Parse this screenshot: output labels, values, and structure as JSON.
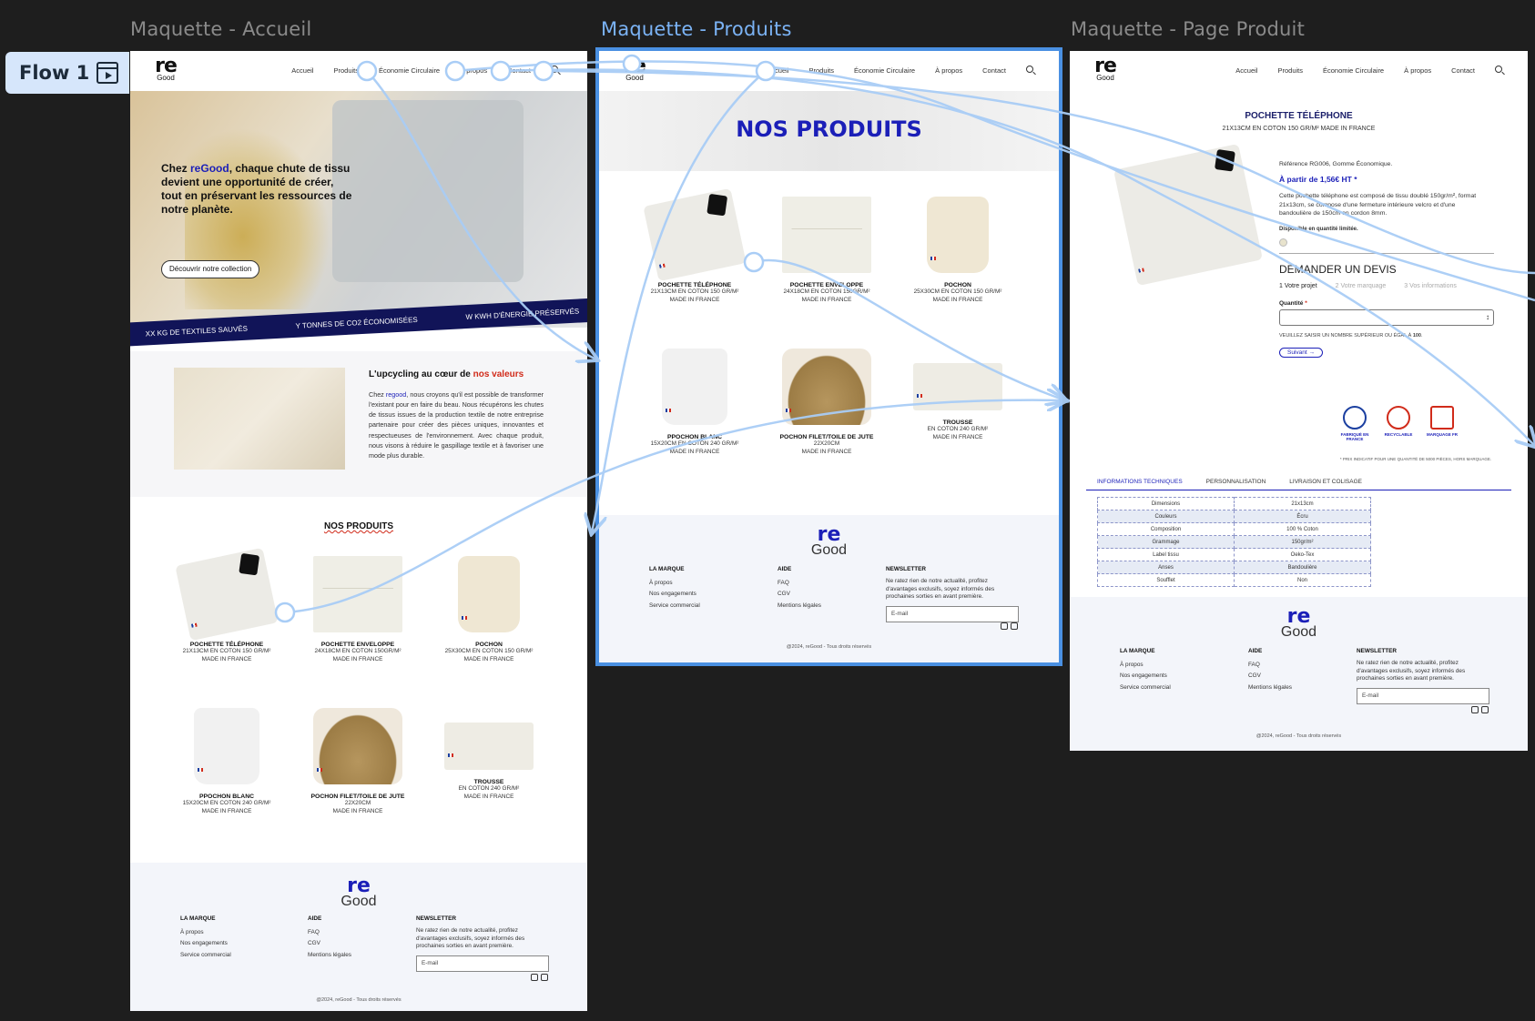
{
  "flow": {
    "label": "Flow 1"
  },
  "frames": {
    "home": {
      "title": "Maquette - Accueil"
    },
    "products": {
      "title": "Maquette - Produits"
    },
    "product": {
      "title": "Maquette - Page Produit"
    }
  },
  "nav": {
    "home_items": [
      "Accueil",
      "Produits",
      "Économie Circulaire",
      "À propos",
      "Contact"
    ],
    "items": [
      "Accueil",
      "Produits",
      "Économie Circulaire",
      "À propos",
      "Contact"
    ]
  },
  "logo": {
    "re": "re",
    "good": "Good"
  },
  "hero": {
    "pre": "Chez ",
    "brand": "reGood",
    "post": ", chaque chute de tissu devient une opportunité de créer, tout en préservant les ressources de notre planète.",
    "cta": "Découvrir notre collection"
  },
  "stats": [
    "XX KG DE TEXTILES SAUVÉS",
    "Y TONNES DE CO2  ÉCONOMISÉES",
    "W KWH D'ÉNERGIE PRÉSERVÉS"
  ],
  "values": {
    "title_pre": "L'upcycling au cœur de ",
    "title_red": "nos valeurs",
    "body_pre": "Chez ",
    "body_brand": "regood",
    "body_post": ", nous croyons qu'il est possible de transformer l'existant pour en faire du beau. Nous récupérons les chutes de tissus issues de la production textile de notre entreprise partenaire pour créer des pièces uniques, innovantes et respectueuses de l'environnement. Avec chaque produit, nous visons à réduire le gaspillage textile et à favoriser une mode plus durable."
  },
  "products_title": "NOS PRODUITS",
  "products_banner": "NOS PRODUITS",
  "products": [
    {
      "name": "POCHETTE TÉLÉPHONE",
      "l1": "21X13CM EN COTON 150 GR/M²",
      "l2": "MADE IN FRANCE",
      "img": "pouch"
    },
    {
      "name": "POCHETTE ENVELOPPE",
      "l1": "24X18CM EN COTON 150GR/M²",
      "l2": "MADE IN FRANCE",
      "img": "env"
    },
    {
      "name": "POCHON",
      "l1": "25X30CM EN COTON 150 GR/M²",
      "l2": "MADE IN FRANCE",
      "img": "bag"
    },
    {
      "name": "PPOCHON BLANC",
      "l1": "15X20CM EN COTON 240 GR/M²",
      "l2": "MADE IN FRANCE",
      "img": "white"
    },
    {
      "name": "POCHON FILET/TOILE DE JUTE",
      "l1": "22X20CM",
      "l2": "MADE IN FRANCE",
      "img": "jute"
    },
    {
      "name": "TROUSSE",
      "l1": "EN COTON 240 GR/M²",
      "l2": "MADE IN FRANCE",
      "img": "case"
    }
  ],
  "footer": {
    "brand_title": "LA MARQUE",
    "brand_links": [
      "À propos",
      "Nos engagements",
      "Service commercial"
    ],
    "help_title": "AIDE",
    "help_links": [
      "FAQ",
      "CGV",
      "Mentions légales"
    ],
    "newsletter_title": "NEWSLETTER",
    "newsletter_text": "Ne ratez rien de notre actualité, profitez d'avantages exclusifs, soyez informés des prochaines sorties en avant première.",
    "email_placeholder": "E-mail",
    "copyright": "@2024, reGood - Tous droits réservés"
  },
  "product_page": {
    "title": "POCHETTE TÉLÉPHONE",
    "subtitle": "21X13CM EN COTON 150 GR/M² MADE IN FRANCE",
    "ref": "Référence RG006, Gomme Économique.",
    "price": "À partir de 1,56€ HT *",
    "desc": "Cette pochette téléphone est composé de tissu doublé 150gr/m², format 21x13cm, se compose d'une fermeture intérieure velcro et d'une bandoulière de 150cm en cordon 8mm.",
    "stock": "Disponible en quantité limitée.",
    "devis_title": "DEMANDER UN DEVIS",
    "steps": [
      "1 Votre projet",
      "2 Votre marquage",
      "3 Vos informations"
    ],
    "qty_label": "Quantité",
    "qty_required": "*",
    "qty_hint_pre": "VEUILLEZ SAISIR UN NOMBRE SUPÉRIEUR OU ÉGAL À ",
    "qty_hint_min": "100",
    "next": "Suivant →",
    "badges": [
      "FABRIQUÉ EN FRANCE",
      "RECYCLABLE",
      "MARQUAGE FR"
    ],
    "disclaimer": "* PRIX INDICATIF POUR UNE QUANTITÉ DE 5000 PIÈCES, HORS MARQUAGE.",
    "tabs": [
      "INFORMATIONS TECHNIQUES",
      "PERSONNALISATION",
      "LIVRAISON ET COLISAGE"
    ],
    "specs": [
      [
        "Dimensions",
        "21x13cm"
      ],
      [
        "Couleurs",
        "Écru"
      ],
      [
        "Composition",
        "100 % Coton"
      ],
      [
        "Grammage",
        "150gr/m²"
      ],
      [
        "Label tissu",
        "Oeko-Tex"
      ],
      [
        "Anses",
        "Bandoulière"
      ],
      [
        "Soufflet",
        "Non"
      ]
    ]
  },
  "colors": {
    "brand_blue": "#1b1fb8",
    "accent_red": "#d12b1a",
    "flow_blue": "#4a90e2",
    "ribbon": "#111458"
  }
}
